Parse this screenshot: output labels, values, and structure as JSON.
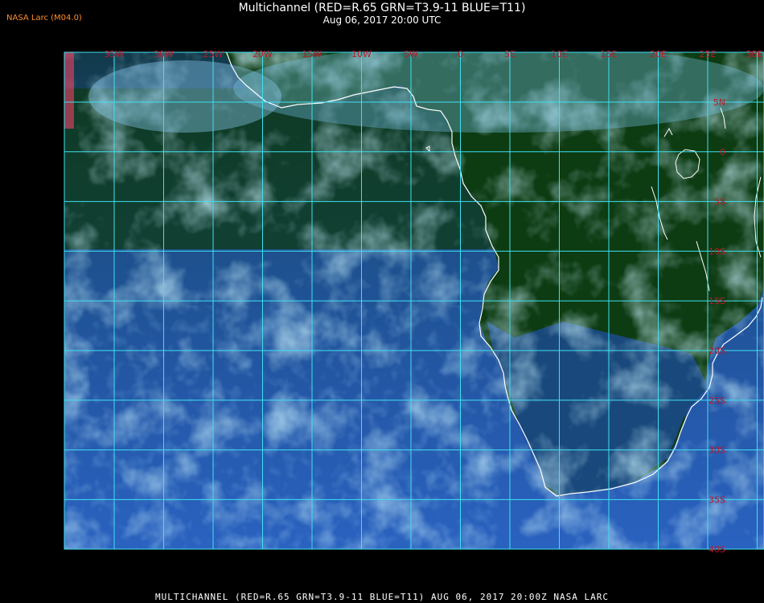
{
  "header": {
    "title": "Multichannel (RED=R.65 GRN=T3.9-11 BLUE=T11)",
    "subtitle": "Aug 06, 2017 20:00 UTC",
    "logo": "NASA Larc (M04.0)"
  },
  "footer": {
    "caption": "MULTICHANNEL (RED=R.65 GRN=T3.9-11 BLUE=T11) AUG 06, 2017 20:00Z  NASA LARC"
  },
  "grid": {
    "lon_labels": [
      "35W",
      "30W",
      "25W",
      "20W",
      "15W",
      "10W",
      "5W",
      "0",
      "5E",
      "10E",
      "15E",
      "20E",
      "25E",
      "30E",
      "35E"
    ],
    "lat_labels": [
      "5N",
      "0",
      "5S",
      "10S",
      "15S",
      "20S",
      "25S",
      "30S",
      "35S",
      "40S"
    ],
    "line_color": "#3fe0f0",
    "label_color": "#c0182a"
  },
  "colors": {
    "land": "#0c3a10",
    "ocean": "#1f4f93",
    "cloud": "#8fd8f5",
    "coast": "#ffffff"
  }
}
